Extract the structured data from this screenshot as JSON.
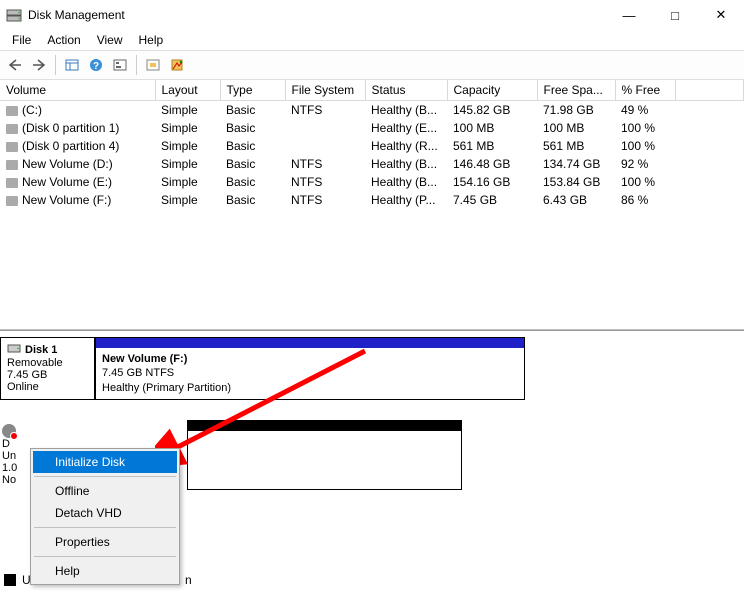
{
  "window": {
    "title": "Disk Management"
  },
  "menu": {
    "file": "File",
    "action": "Action",
    "view": "View",
    "help": "Help"
  },
  "headers": {
    "volume": "Volume",
    "layout": "Layout",
    "type": "Type",
    "filesystem": "File System",
    "status": "Status",
    "capacity": "Capacity",
    "freespace": "Free Spa...",
    "pctfree": "% Free"
  },
  "volumes": [
    {
      "name": "(C:)",
      "layout": "Simple",
      "type": "Basic",
      "fs": "NTFS",
      "status": "Healthy (B...",
      "capacity": "145.82 GB",
      "free": "71.98 GB",
      "pct": "49 %"
    },
    {
      "name": "(Disk 0 partition 1)",
      "layout": "Simple",
      "type": "Basic",
      "fs": "",
      "status": "Healthy (E...",
      "capacity": "100 MB",
      "free": "100 MB",
      "pct": "100 %"
    },
    {
      "name": "(Disk 0 partition 4)",
      "layout": "Simple",
      "type": "Basic",
      "fs": "",
      "status": "Healthy (R...",
      "capacity": "561 MB",
      "free": "561 MB",
      "pct": "100 %"
    },
    {
      "name": "New Volume (D:)",
      "layout": "Simple",
      "type": "Basic",
      "fs": "NTFS",
      "status": "Healthy (B...",
      "capacity": "146.48 GB",
      "free": "134.74 GB",
      "pct": "92 %"
    },
    {
      "name": "New Volume (E:)",
      "layout": "Simple",
      "type": "Basic",
      "fs": "NTFS",
      "status": "Healthy (B...",
      "capacity": "154.16 GB",
      "free": "153.84 GB",
      "pct": "100 %"
    },
    {
      "name": "New Volume (F:)",
      "layout": "Simple",
      "type": "Basic",
      "fs": "NTFS",
      "status": "Healthy (P...",
      "capacity": "7.45 GB",
      "free": "6.43 GB",
      "pct": "86 %"
    }
  ],
  "disk1": {
    "title": "Disk 1",
    "type": "Removable",
    "size": "7.45 GB",
    "status": "Online",
    "vol_name": "New Volume  (F:)",
    "vol_size": "7.45 GB NTFS",
    "vol_status": "Healthy (Primary Partition)",
    "bar_color": "#2020c8"
  },
  "disk2": {
    "title_initial": "D",
    "status_partial": "Un",
    "size_partial": "1.0",
    "init_partial": "No",
    "bar_color": "#000000"
  },
  "context_menu": {
    "initialize": "Initialize Disk",
    "offline": "Offline",
    "detach": "Detach VHD",
    "properties": "Properties",
    "help": "Help"
  },
  "legend": {
    "label_partial": "U",
    "label_suffix": "n"
  },
  "arrow": {
    "color": "#ff0000"
  }
}
